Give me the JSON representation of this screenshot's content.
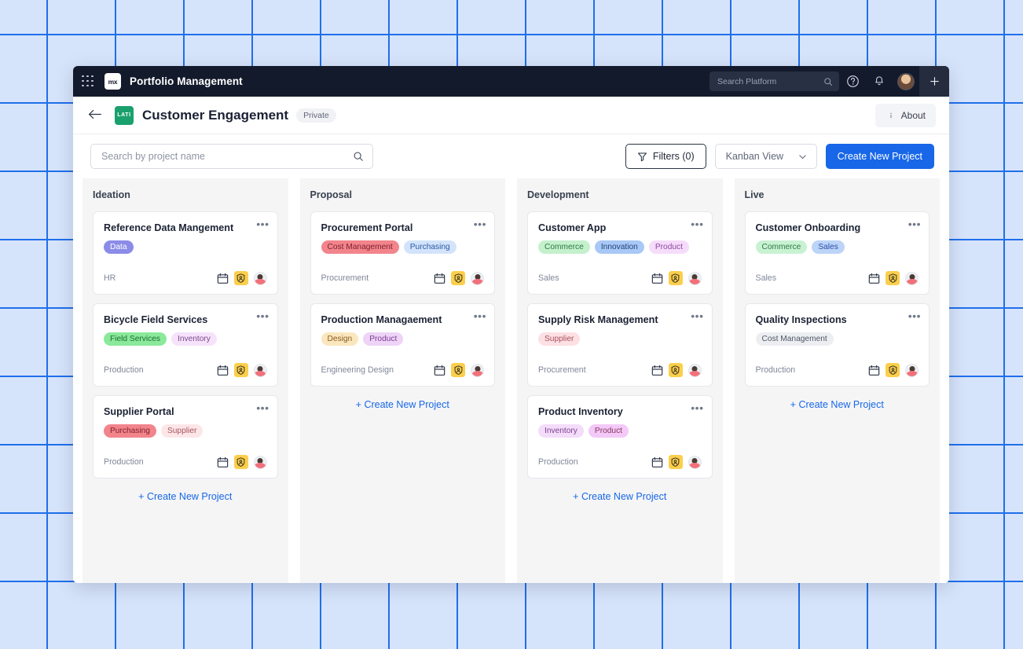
{
  "topnav": {
    "apps_icon": "grid-apps-icon",
    "logo_text": "mx",
    "app_title": "Portfolio Management",
    "search": {
      "placeholder": "Search Platform",
      "icon": "search-icon"
    },
    "help_icon": "help-circle-icon",
    "notification_icon": "bell-icon",
    "avatar": "user-avatar",
    "add_icon": "plus-icon"
  },
  "header": {
    "back_icon": "arrow-left-icon",
    "project_badge_text": "LATI",
    "title": "Customer Engagement",
    "visibility": "Private",
    "about_label": "About",
    "about_icon": "info-circle-icon"
  },
  "toolbar": {
    "search_placeholder": "Search by project name",
    "search_icon": "search-icon",
    "filters_label": "Filters (0)",
    "filters_icon": "funnel-icon",
    "view_value": "Kanban View",
    "view_caret": "chevron-down-icon",
    "create_label": "Create New Project"
  },
  "board": {
    "create_link_label": "+ Create New Project",
    "card_menu_glyph": "•••",
    "icons": {
      "calendar": "calendar-icon",
      "shield": "shield-badge-icon",
      "avatar": "assignee-avatar-icon"
    },
    "columns": [
      {
        "title": "Ideation",
        "cards": [
          {
            "title": "Reference Data Mangement",
            "tags": [
              {
                "label": "Data",
                "bg": "#8b8ce8",
                "fg": "#ffffff"
              }
            ],
            "dept": "HR"
          },
          {
            "title": "Bicycle Field Services",
            "tags": [
              {
                "label": "Field Services",
                "bg": "#8ae99a",
                "fg": "#1f6b33"
              },
              {
                "label": "Inventory",
                "bg": "#f6e2fb",
                "fg": "#7a4a8c"
              }
            ],
            "dept": "Production"
          },
          {
            "title": "Supplier Portal",
            "tags": [
              {
                "label": "Purchasing",
                "bg": "#f2848c",
                "fg": "#7d1f2a"
              },
              {
                "label": "Supplier",
                "bg": "#fde6e8",
                "fg": "#a6545c"
              }
            ],
            "dept": "Production"
          }
        ]
      },
      {
        "title": "Proposal",
        "cards": [
          {
            "title": "Procurement Portal",
            "tags": [
              {
                "label": "Cost Management",
                "bg": "#f2848c",
                "fg": "#7d1f2a"
              },
              {
                "label": "Purchasing",
                "bg": "#d3e3fb",
                "fg": "#2a5aa8"
              }
            ],
            "dept": "Procurement"
          },
          {
            "title": "Production Managaement",
            "tags": [
              {
                "label": "Design",
                "bg": "#fae7bd",
                "fg": "#8a5a22"
              },
              {
                "label": "Product",
                "bg": "#eed4f7",
                "fg": "#7a3d93"
              }
            ],
            "dept": "Engineering Design"
          }
        ]
      },
      {
        "title": "Development",
        "cards": [
          {
            "title": "Customer App",
            "tags": [
              {
                "label": "Commerce",
                "bg": "#c4f0cc",
                "fg": "#2f7a45"
              },
              {
                "label": "Innovation",
                "bg": "#a8c8f5",
                "fg": "#22437e"
              },
              {
                "label": "Product",
                "bg": "#f6dcfb",
                "fg": "#8a4a9c"
              }
            ],
            "dept": "Sales"
          },
          {
            "title": "Supply Risk Management",
            "tags": [
              {
                "label": "Supplier",
                "bg": "#fde0e4",
                "fg": "#a8505c"
              }
            ],
            "dept": "Procurement"
          },
          {
            "title": "Product Inventory",
            "tags": [
              {
                "label": "Inventory",
                "bg": "#f4dcfb",
                "fg": "#7c4490"
              },
              {
                "label": "Product",
                "bg": "#f3c9f7",
                "fg": "#8a3a60"
              }
            ],
            "dept": "Production"
          }
        ]
      },
      {
        "title": "Live",
        "cards": [
          {
            "title": "Customer Onboarding",
            "tags": [
              {
                "label": "Commerce",
                "bg": "#c8f2d2",
                "fg": "#2f7a45"
              },
              {
                "label": "Sales",
                "bg": "#bcd4f8",
                "fg": "#2b4ea8"
              }
            ],
            "dept": "Sales"
          },
          {
            "title": "Quality Inspections",
            "tags": [
              {
                "label": "Cost Management",
                "bg": "#edeef1",
                "fg": "#4d5566"
              }
            ],
            "dept": "Production"
          }
        ]
      }
    ]
  }
}
